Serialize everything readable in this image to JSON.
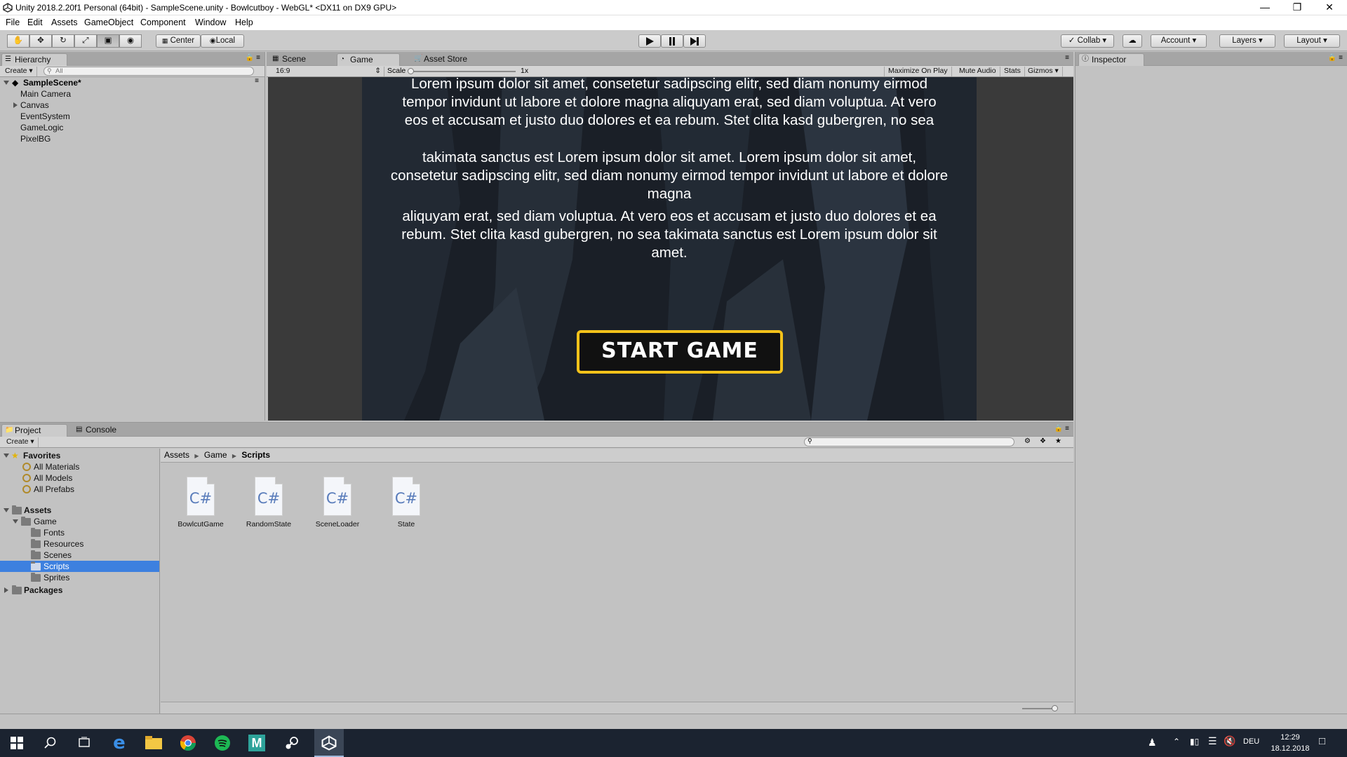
{
  "window": {
    "title": "Unity 2018.2.20f1 Personal (64bit) - SampleScene.unity - Bowlcutboy - WebGL* <DX11 on DX9 GPU>"
  },
  "menu": [
    "File",
    "Edit",
    "Assets",
    "GameObject",
    "Component",
    "Window",
    "Help"
  ],
  "toolbar": {
    "center_label": "Center",
    "local_label": "Local",
    "collab_label": "Collab",
    "account_label": "Account",
    "layers_label": "Layers",
    "layout_label": "Layout"
  },
  "hierarchy": {
    "tab_label": "Hierarchy",
    "create_label": "Create",
    "search_placeholder": "All",
    "scene_name": "SampleScene*",
    "items": [
      "Main Camera",
      "Canvas",
      "EventSystem",
      "GameLogic",
      "PixelBG"
    ]
  },
  "center_tabs": {
    "scene": "Scene",
    "game": "Game",
    "asset_store": "Asset Store"
  },
  "game_bar": {
    "aspect": "16:9",
    "scale_label": "Scale",
    "scale_value": "1x",
    "maximize": "Maximize On Play",
    "mute": "Mute Audio",
    "stats": "Stats",
    "gizmos": "Gizmos"
  },
  "game": {
    "paragraph1": "Lorem ipsum dolor sit amet, consetetur sadipscing elitr, sed diam nonumy eirmod tempor invidunt ut labore et dolore magna aliquyam erat, sed diam voluptua. At vero eos et accusam et justo duo dolores et ea rebum. Stet clita kasd gubergren, no sea",
    "paragraph2": "takimata sanctus est Lorem ipsum dolor sit amet. Lorem ipsum dolor sit amet, consetetur sadipscing elitr, sed diam nonumy eirmod tempor invidunt ut labore et dolore magna",
    "paragraph3": "aliquyam erat, sed diam voluptua. At vero eos et accusam et justo duo dolores et ea rebum. Stet clita kasd gubergren, no sea takimata sanctus est Lorem ipsum dolor sit amet.",
    "start_button": "START GAME"
  },
  "inspector": {
    "tab_label": "Inspector"
  },
  "project": {
    "tab_project": "Project",
    "tab_console": "Console",
    "create_label": "Create",
    "favorites_label": "Favorites",
    "favorites": [
      "All Materials",
      "All Models",
      "All Prefabs"
    ],
    "assets_label": "Assets",
    "game_folder": "Game",
    "game_subfolders": [
      "Fonts",
      "Resources",
      "Scenes",
      "Scripts",
      "Sprites"
    ],
    "packages_label": "Packages",
    "breadcrumb": [
      "Assets",
      "Game",
      "Scripts"
    ],
    "files": [
      "BowlcutGame",
      "RandomState",
      "SceneLoader",
      "State"
    ],
    "file_icon_text": "C#"
  },
  "taskbar": {
    "language": "DEU",
    "time": "12:29",
    "date": "18.12.2018"
  }
}
